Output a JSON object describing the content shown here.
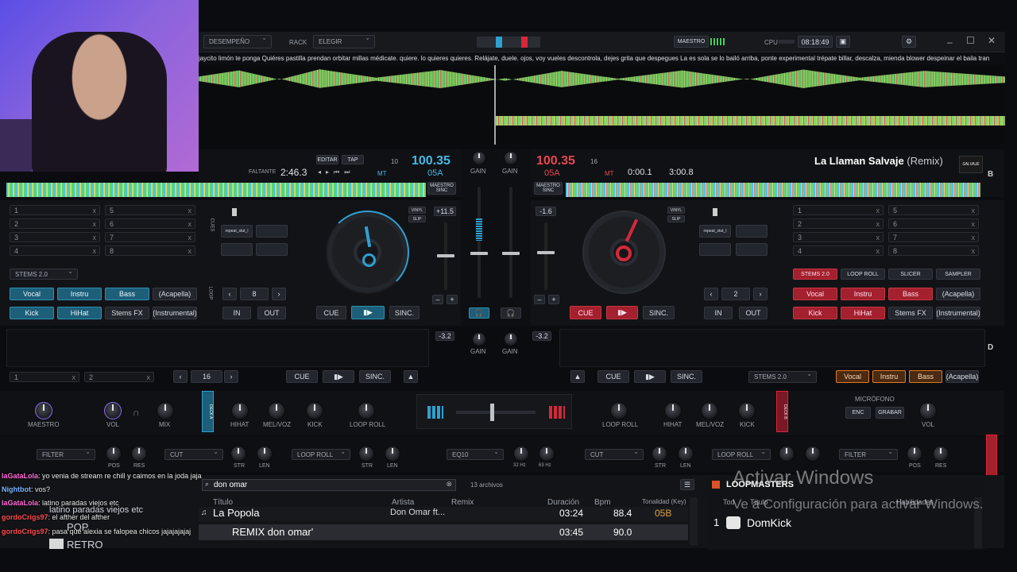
{
  "topbar": {
    "mode": "DESEMPEÑO",
    "rack_label": "RACK",
    "rack_value": "ELEGIR",
    "master_label": "MAESTRO",
    "cpu_label": "CPU",
    "clock": "08:18:49"
  },
  "lyrics": "jaycito limón te ponga Quiéres pastilla prendan orbitar millas médicate. quiere. lo quieres quieres. Relájate, duele. ojos, voy vueles descontrola, dejes grita que despegues La es sola se lo bailó arriba, ponte experimental trépate billar, descalza, mienda blower despeinar el baila tran",
  "deckA": {
    "edit_label": "EDITAR",
    "tap_label": "TAP",
    "remaining_label": "FALTANTE",
    "remaining_time": "2:46.3",
    "bpm": "100.35",
    "key": "05A",
    "mt": "MT",
    "beat_num": "10",
    "master_sync": "MAESTRO SINC",
    "pitch": "+11.5",
    "stems_label": "STEMS 2.0",
    "stems": [
      "Vocal",
      "Instru",
      "Bass",
      "(Acapella)"
    ],
    "stems2": [
      "Kick",
      "HiHat",
      "Stems FX",
      "(Instrumental)"
    ],
    "loop_value": "8",
    "in_label": "IN",
    "out_label": "OUT",
    "cue": "CUE",
    "play": "▮▶",
    "sync": "SINC.",
    "vinyl": "VINYL",
    "slip": "SLIP",
    "cues_left": [
      "1",
      "2",
      "3",
      "4"
    ],
    "cues_right": [
      "5",
      "6",
      "7",
      "8"
    ],
    "fx_label": "repeat_stut_l",
    "loop_side": "LOOP",
    "cue_side": "CUES"
  },
  "deckB": {
    "title": "La Llaman Salvaje",
    "remix": "(Remix)",
    "bpm": "100.35",
    "beat_num": "16",
    "key": "05A",
    "mt": "MT",
    "elapsed": "0:00.1",
    "total": "3:00.8",
    "master_sync": "MAESTRO SINC",
    "pitch": "-1.6",
    "stems_label": "STEMS 2.0",
    "loop_roll": "LOOP ROLL",
    "slicer": "SLICER",
    "sampler": "SAMPLER",
    "stems": [
      "Vocal",
      "Instru",
      "Bass",
      "(Acapella)"
    ],
    "stems2": [
      "Kick",
      "HiHat",
      "Stems FX",
      "(Instrumental)"
    ],
    "loop_value": "2",
    "in_label": "IN",
    "out_label": "OUT",
    "cue": "CUE",
    "play": "▮▶",
    "sync": "SINC.",
    "cues_left": [
      "1",
      "2",
      "3",
      "4"
    ],
    "cues_right": [
      "5",
      "6",
      "7",
      "8"
    ],
    "fx_label": "repeat_stut_l",
    "logo": "SALVAJE",
    "side": "B"
  },
  "mixer": {
    "gain": "GAIN",
    "gainA": "-3.2",
    "gainB": "-3.2"
  },
  "deckC": {
    "slot1": "1",
    "slot2": "2",
    "loop_value": "16",
    "cue": "CUE",
    "play": "▮▶",
    "sync": "SINC."
  },
  "deckD": {
    "cue": "CUE",
    "play": "▮▶",
    "sync": "SINC.",
    "stems_label": "STEMS 2.0",
    "stems": [
      "Vocal",
      "Instru",
      "Bass",
      "(Acapella)"
    ],
    "side": "D"
  },
  "fxrow": {
    "master": "MAESTRO",
    "vol": "VOL",
    "mix": "MIX",
    "hihat": "HIHAT",
    "melvoz": "MEL/VOZ",
    "kick": "KICK",
    "loop_roll": "LOOP ROLL",
    "mic_label": "MICRÓFONO",
    "enc": "ENC",
    "grabar": "GRABAR",
    "vol_right": "VOL",
    "deck_tab": "DECK A",
    "deck_tab_b": "DECK B"
  },
  "bottomrow": {
    "filter": "FILTER",
    "cut": "CUT",
    "loop_roll": "LOOP ROLL",
    "eq": "EQ10",
    "pos": "POS",
    "res": "RES",
    "str": "STR",
    "len": "LEN",
    "hz32": "32 Hz",
    "hz63": "63 Hz"
  },
  "browser": {
    "search": "don omar",
    "count": "13 archivos",
    "columns": [
      "Título",
      "Artista",
      "Remix",
      "Duración",
      "Bpm",
      "Tonalidad (Key)"
    ],
    "rows": [
      {
        "title": "La Popola",
        "artist": "Don Omar ft...",
        "remix": "",
        "duration": "03:24",
        "bpm": "88.4",
        "key": "05B"
      },
      {
        "title": "REMIX don omar'",
        "artist": "",
        "remix": "",
        "duration": "03:45",
        "bpm": "90.0",
        "key": ""
      }
    ],
    "folders": [
      "latino paradas viejos etc",
      "POP",
      "RETRO"
    ],
    "right_header": "LOOPMASTERS",
    "right_col1": "Tod",
    "right_col2": "Título",
    "right_col3": "Habilidades",
    "right_row_num": "1",
    "right_row_title": "DomKick"
  },
  "watermark": {
    "line1": "Activar Windows",
    "line2": "Ve a Configuración para activar Windows."
  },
  "chat": [
    {
      "user": "laGataLola",
      "msg": ": yo venia de stream re chill y caimos en la joda jaja",
      "color": "#ff6ad5"
    },
    {
      "user": "Nightbot",
      "msg": ": vos?",
      "color": "#7ab4ff"
    },
    {
      "user": "laGataLola",
      "msg": ": latino paradas viejos etc",
      "color": "#ff6ad5"
    },
    {
      "user": "gordoCrigs97",
      "msg": ": el afther del afther",
      "color": "#ff4b4b"
    },
    {
      "user": "gordoCrigs97",
      "msg": ": pasa que alexia se falopea chicos jajajajajaj",
      "color": "#ff4b4b"
    }
  ],
  "colors": {
    "accent_blue": "#2fa0d0",
    "accent_red": "#d6283a",
    "webcam_bg": "#7b5bd6"
  }
}
